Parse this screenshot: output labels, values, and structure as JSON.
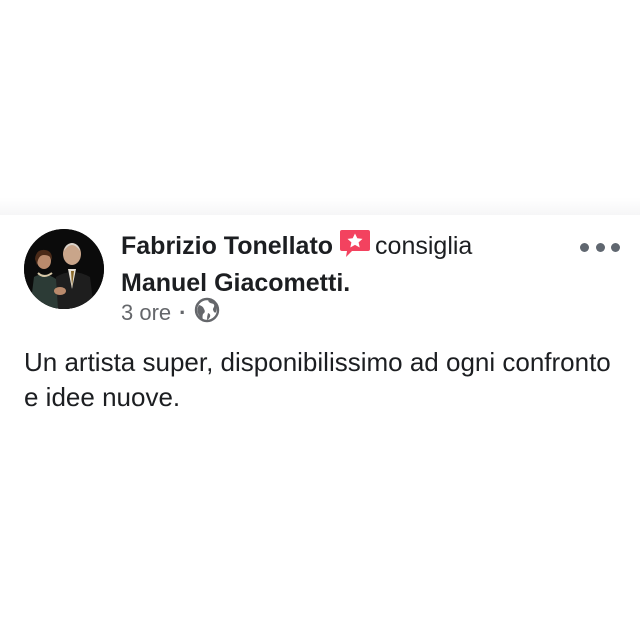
{
  "post": {
    "author": "Fabrizio Tonellato",
    "action": "consiglia",
    "target": "Manuel Giacometti.",
    "timestamp": "3 ore",
    "separator": "·",
    "privacy_icon": "globe-icon",
    "recommend_icon": "recommendation-star-icon",
    "more_icon": "more-horizontal-icon",
    "text": "Un artista super, disponibilissimo ad ogni confronto e idee nuove."
  },
  "colors": {
    "text": "#1c1e21",
    "meta": "#65676b",
    "recommend_badge": "#f3425f"
  }
}
